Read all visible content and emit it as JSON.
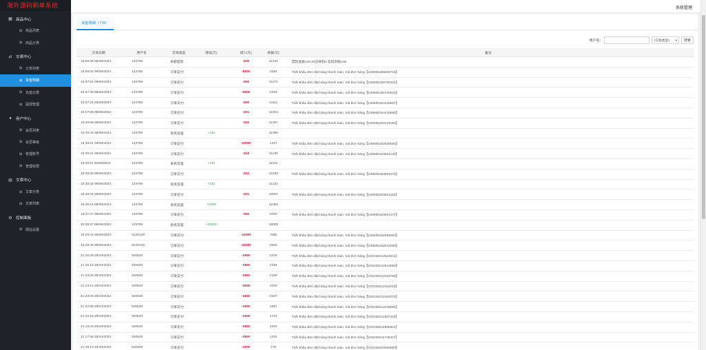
{
  "app": {
    "brand": "海外源码刷单系统",
    "top_right": "系统管理"
  },
  "sidebar": {
    "groups": [
      {
        "label": "商品中心",
        "icon": "grid-icon",
        "items": [
          {
            "label": "商品列表"
          },
          {
            "label": "商品分类"
          }
        ]
      },
      {
        "label": "交易中心",
        "icon": "exchange-icon",
        "items": [
          {
            "label": "订单列表"
          },
          {
            "label": "资金明细",
            "active": true
          },
          {
            "label": "充值记录"
          },
          {
            "label": "提现管理"
          }
        ]
      },
      {
        "label": "用户中心",
        "icon": "user-icon",
        "items": [
          {
            "label": "会员列表"
          },
          {
            "label": "会员等级"
          },
          {
            "label": "管理账号"
          },
          {
            "label": "管理权限"
          }
        ]
      },
      {
        "label": "文章中心",
        "icon": "file-icon",
        "items": [
          {
            "label": "文章分类"
          },
          {
            "label": "文章列表"
          }
        ]
      },
      {
        "label": "控制面板",
        "icon": "gear-icon",
        "items": [
          {
            "label": "网站设置"
          }
        ]
      }
    ]
  },
  "tab": {
    "label": "资金明细（778）"
  },
  "filter": {
    "username_label": "用户名:",
    "type_select": "≡交易类型≡",
    "search_button": "搜索"
  },
  "table": {
    "headers": [
      "交易日期",
      "用户名",
      "交易类型",
      "增加(元)",
      "减少(元)",
      "余额(元)",
      "备注"
    ],
    "rows": [
      [
        "15:59:36 06/08/2024",
        "123789",
        "余额提现",
        "",
        "-100",
        "11432",
        "提现金额100.00涉单扣0.实际到账100"
      ],
      [
        "15:58:02 06/08/2024",
        "123789",
        "订单支付",
        "",
        "-8000",
        "3492",
        "Triết khấu đơn đặt hàng thanh toán, mã đơn hàng【240806155849715】"
      ],
      [
        "15:57:54 06/08/2024",
        "123789",
        "订单支付",
        "",
        "-300",
        "11174",
        "Triết khấu đơn đặt hàng thanh toán, mã đơn hàng【240806155730341】"
      ],
      [
        "15:57:39 06/08/2024",
        "123789",
        "订单支付",
        "",
        "-9000",
        "2429",
        "Triết khấu đơn đặt hàng thanh toán, mã đơn hàng【240806155726625】"
      ],
      [
        "15:57:24 06/08/2024",
        "123789",
        "订单支付",
        "",
        "-300",
        "11111",
        "Triết khấu đơn đặt hàng thanh toán, mã đơn hàng【240806154410507】"
      ],
      [
        "15:57:08 06/08/2024",
        "123789",
        "订单支付",
        "",
        "-101",
        "11304",
        "Triết khấu đơn đặt hàng thanh toán, mã đơn hàng【240806154410665】"
      ],
      [
        "15:49:59 06/08/2024",
        "123789",
        "订单支付",
        "",
        "-102",
        "11297",
        "Triết khấu đơn đặt hàng thanh toán, mã đơn hàng【240806154410155】"
      ],
      [
        "15:49:44 06/08/2024",
        "123789",
        "系统充值",
        "+102",
        "",
        "11399",
        ""
      ],
      [
        "15:39:51 06/08/2024",
        "123789",
        "订单支付",
        "",
        "-10000",
        "1347",
        "Triết khấu đơn đặt hàng thanh toán, mã đơn hàng【240806153030564】"
      ],
      [
        "15:39:21 06/08/2024",
        "123789",
        "订单支付",
        "",
        "-103",
        "11138",
        "Triết khấu đơn đặt hàng thanh toán, mã đơn hàng【240806153601130】"
      ],
      [
        "15:39:11 06/08/2024",
        "123789",
        "系统充值",
        "+101",
        "",
        "11241",
        ""
      ],
      [
        "15:38:53 06/08/2024",
        "123789",
        "订单支付",
        "",
        "-102",
        "11030",
        "Triết khấu đơn đặt hàng thanh toán, mã đơn hàng【240806153601676】"
      ],
      [
        "15:38:42 06/08/2024",
        "123789",
        "系统充值",
        "+102",
        "",
        "11132",
        ""
      ],
      [
        "15:38:24 06/08/2024",
        "123789",
        "订单支付",
        "",
        "-201",
        "10857",
        "Triết khấu đơn đặt hàng thanh toán, mã đơn hàng【240806153601162】"
      ],
      [
        "15:38:13 06/08/2024",
        "123789",
        "系统充值",
        "+1000",
        "",
        "11058",
        ""
      ],
      [
        "15:37:27 06/08/2024",
        "123789",
        "订单支付",
        "",
        "-300",
        "9700",
        "Triết khấu đơn đặt hàng thanh toán, mã đơn hàng【240806153601377】"
      ],
      [
        "15:35:27 06/08/2024",
        "123789",
        "系统充值",
        "+10000",
        "",
        "10000",
        ""
      ],
      [
        "15:29:41 06/08/2024",
        "8120120",
        "订单支付",
        "",
        "-12000",
        "7085",
        "Triết khấu đơn đặt hàng thanh toán, mã đơn hàng【240806152939294】"
      ],
      [
        "15:28:46 06/08/2024",
        "8120120",
        "订单支付",
        "",
        "-16000",
        "2925",
        "Triết khấu đơn đặt hàng thanh toán, mã đơn hàng【240806152844250】"
      ],
      [
        "21:26:29 28/10/2023",
        "520520",
        "订单支付",
        "",
        "-1900",
        "2278",
        "Triết khấu đơn đặt hàng thanh toán, mã đơn hàng【231028212624811】"
      ],
      [
        "21:26:15 28/10/2023",
        "520520",
        "订单支付",
        "",
        "-1950",
        "2189",
        "Triết khấu đơn đặt hàng thanh toán, mã đơn hàng【231028212613882】"
      ],
      [
        "21:23:20 28/10/2023",
        "520520",
        "订单支付",
        "",
        "-1950",
        "2150",
        "Triết khấu đơn đặt hàng thanh toán, mã đơn hàng【231028212316769】"
      ],
      [
        "21:23:13 28/10/2023",
        "520520",
        "订单支付",
        "",
        "-3000",
        "1040",
        "Triết khấu đơn đặt hàng thanh toán, mã đơn hàng【231028212311016】"
      ],
      [
        "21:23:03 28/10/2023",
        "520520",
        "订单支付",
        "",
        "-1650",
        "2337",
        "Triết khấu đơn đặt hàng thanh toán, mã đơn hàng【231028212302075】"
      ],
      [
        "21:22:58 28/10/2023",
        "520520",
        "订单支付",
        "",
        "-2050",
        "1967",
        "Triết khấu đơn đặt hàng thanh toán, mã đơn hàng【231028212248895】"
      ],
      [
        "21:22:19 28/10/2023",
        "520520",
        "订单支付",
        "",
        "-2200",
        "1723",
        "Triết khấu đơn đặt hàng thanh toán, mã đơn hàng【231028211827443】"
      ],
      [
        "21:18:23 28/10/2023",
        "520520",
        "订单支付",
        "",
        "-1950",
        "1934",
        "Triết khấu đơn đặt hàng thanh toán, mã đơn hàng【231028211602501】"
      ],
      [
        "21:17:56 28/10/2023",
        "520520",
        "订单支付",
        "",
        "-2500",
        "1234",
        "Triết khấu đơn đặt hàng thanh toán, mã đơn hàng【231028211746347】"
      ],
      [
        "21:48:13 28/10/2023",
        "520520",
        "订单支付",
        "",
        "-2000",
        "776",
        "Triết khấu đơn đặt hàng thanh toán, mã đơn hàng【231028204030983】"
      ]
    ]
  },
  "colors": {
    "sidebar_bg": "#1f2329",
    "brand_red": "#e8292b",
    "active_blue": "#1f8fe0",
    "increase_green": "#2fa84a",
    "decrease_red": "#d0112b"
  }
}
